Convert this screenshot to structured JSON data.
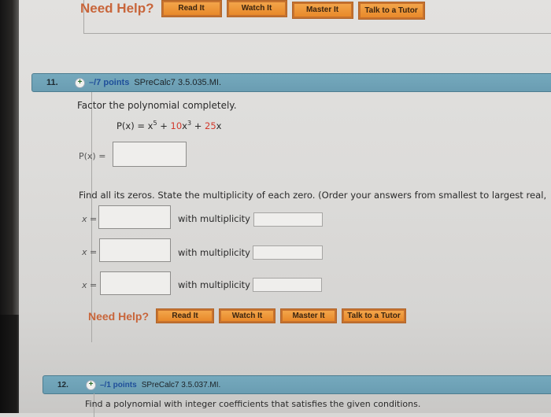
{
  "previous_question": {
    "help": {
      "label": "Need Help?",
      "buttons": [
        "Read It",
        "Watch It",
        "Master It",
        "Talk to a Tutor"
      ]
    }
  },
  "question11": {
    "number": "11.",
    "points": "–/7 points",
    "source": "SPreCalc7 3.5.035.MI.",
    "instruction": "Factor the polynomial completely.",
    "polynomial": {
      "lhs": "P(x) = x",
      "exp1": "5",
      "plus1": " + ",
      "coef1": "10",
      "term2": "x",
      "exp2": "3",
      "plus2": " + ",
      "coef2": "25",
      "term3": "x"
    },
    "factor_label": "P(x) =",
    "factor_value": "",
    "zeros_instruction": "Find all its zeros. State the multiplicity of each zero. (Order your answers from smallest to largest real,",
    "zeros": [
      {
        "x_label": "x =",
        "x_value": "",
        "mult_label": "with multiplicity",
        "mult_value": ""
      },
      {
        "x_label": "x =",
        "x_value": "",
        "mult_label": "with multiplicity",
        "mult_value": ""
      },
      {
        "x_label": "x =",
        "x_value": "",
        "mult_label": "with multiplicity",
        "mult_value": ""
      }
    ],
    "help": {
      "label": "Need Help?",
      "buttons": [
        "Read It",
        "Watch It",
        "Master It",
        "Talk to a Tutor"
      ]
    }
  },
  "question12": {
    "number": "12.",
    "points": "–/1 points",
    "source": "SPreCalc7 3.5.037.MI.",
    "instruction": "Find a polynomial with integer coefficients that satisfies the given conditions."
  },
  "colors": {
    "header_bar": "#6a9db2",
    "help_orange": "#e8892a",
    "need_help_text": "#c8653a",
    "points_blue": "#1f4f9a",
    "coefficient_red": "#d23a2e"
  }
}
